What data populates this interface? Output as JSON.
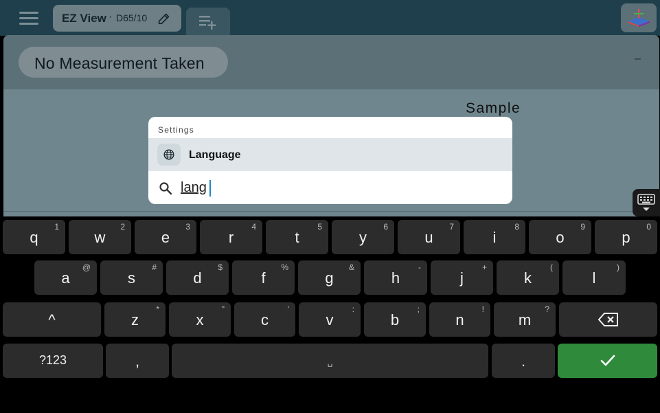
{
  "topbar": {
    "tab_title": "EZ View",
    "tab_separator": "·",
    "tab_illuminant": "D65/10"
  },
  "panel": {
    "status": "No Measurement Taken",
    "collapse_symbol": "–",
    "sample_label": "Sample"
  },
  "search_dialog": {
    "section_header": "Settings",
    "result_label": "Language",
    "query": "lang"
  },
  "keyboard": {
    "row1": [
      {
        "key": "q",
        "hint": "1"
      },
      {
        "key": "w",
        "hint": "2"
      },
      {
        "key": "e",
        "hint": "3"
      },
      {
        "key": "r",
        "hint": "4"
      },
      {
        "key": "t",
        "hint": "5"
      },
      {
        "key": "y",
        "hint": "6"
      },
      {
        "key": "u",
        "hint": "7"
      },
      {
        "key": "i",
        "hint": "8"
      },
      {
        "key": "o",
        "hint": "9"
      },
      {
        "key": "p",
        "hint": "0"
      }
    ],
    "row2": [
      {
        "key": "a",
        "hint": "@"
      },
      {
        "key": "s",
        "hint": "#"
      },
      {
        "key": "d",
        "hint": "$"
      },
      {
        "key": "f",
        "hint": "%"
      },
      {
        "key": "g",
        "hint": "&"
      },
      {
        "key": "h",
        "hint": "-"
      },
      {
        "key": "j",
        "hint": "+"
      },
      {
        "key": "k",
        "hint": "("
      },
      {
        "key": "l",
        "hint": ")"
      }
    ],
    "row3": [
      {
        "key": "z",
        "hint": "*"
      },
      {
        "key": "x",
        "hint": "\""
      },
      {
        "key": "c",
        "hint": "'"
      },
      {
        "key": "v",
        "hint": ":"
      },
      {
        "key": "b",
        "hint": ";"
      },
      {
        "key": "n",
        "hint": "!"
      },
      {
        "key": "m",
        "hint": "?"
      }
    ],
    "shift": "^",
    "symbols": "?123",
    "comma": ",",
    "space": "␣",
    "period": ".",
    "enter_color": "#2f8a3c"
  }
}
